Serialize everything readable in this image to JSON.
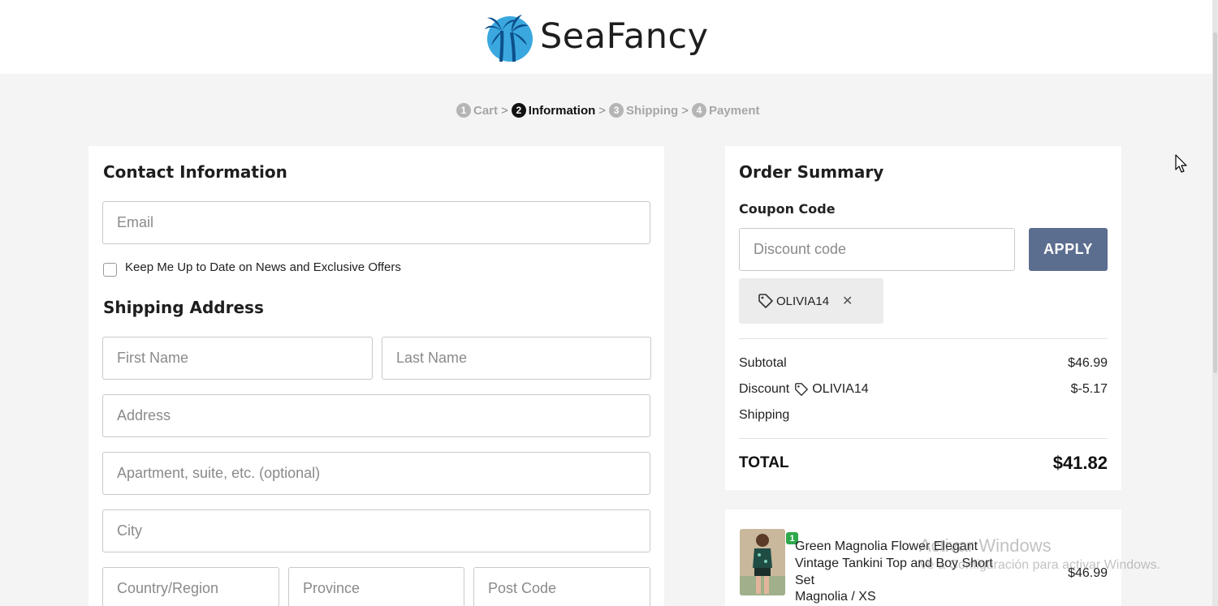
{
  "brand": {
    "name": "SeaFancy",
    "colors": {
      "palm": "#1f78b4",
      "sun": "#3aa8df"
    }
  },
  "steps": [
    {
      "num": "1",
      "label": "Cart"
    },
    {
      "num": "2",
      "label": "Information"
    },
    {
      "num": "3",
      "label": "Shipping"
    },
    {
      "num": "4",
      "label": "Payment"
    }
  ],
  "separator": ">",
  "contact": {
    "title": "Contact Information",
    "email_placeholder": "Email",
    "newsletter_label": "Keep Me Up to Date on News and Exclusive Offers"
  },
  "shipping": {
    "title": "Shipping Address",
    "first_name_placeholder": "First Name",
    "last_name_placeholder": "Last Name",
    "address_placeholder": "Address",
    "apartment_placeholder": "Apartment, suite, etc. (optional)",
    "city_placeholder": "City",
    "country_placeholder": "Country/Region",
    "province_placeholder": "Province",
    "postcode_placeholder": "Post Code"
  },
  "summary": {
    "title": "Order Summary",
    "coupon_label": "Coupon Code",
    "discount_placeholder": "Discount code",
    "apply_label": "APPLY",
    "applied_code": "OLIVIA14",
    "remove_symbol": "✕",
    "subtotal_label": "Subtotal",
    "subtotal_value": "$46.99",
    "discount_label": "Discount",
    "discount_code": "OLIVIA14",
    "discount_value": "$-5.17",
    "shipping_label": "Shipping",
    "total_label": "TOTAL",
    "total_value": "$41.82",
    "accent_color": "#5c6e8f"
  },
  "product": {
    "quantity": "1",
    "name": "Green Magnolia Flower Elegant Vintage Tankini Top and Boy Short Set",
    "variant": "Magnolia / XS",
    "price": "$46.99"
  },
  "watermark": {
    "line1": "Activar Windows",
    "line2": "Ve a Configuración para activar Windows."
  }
}
